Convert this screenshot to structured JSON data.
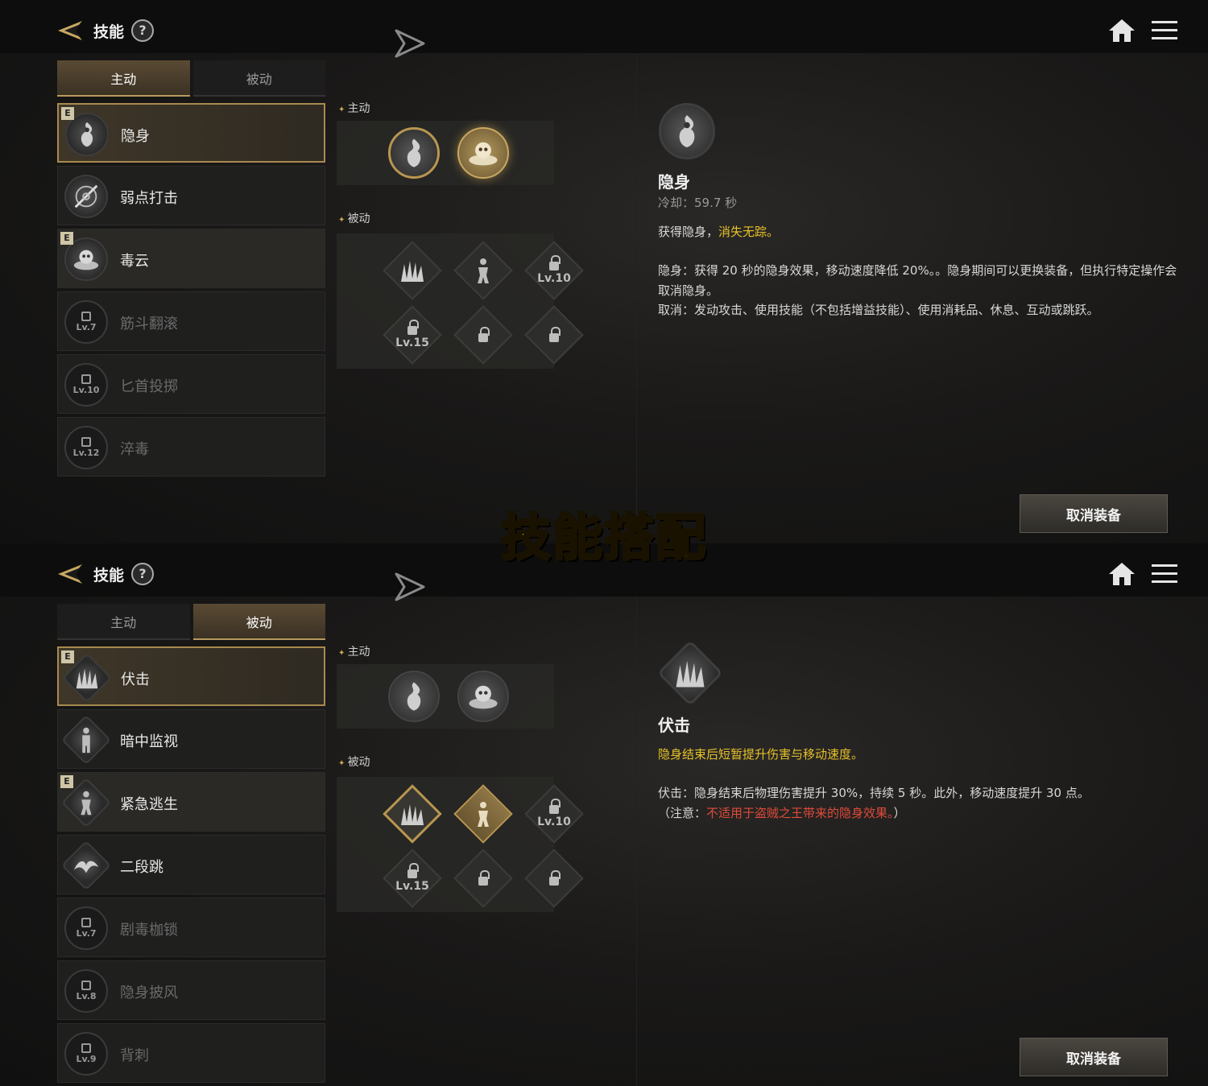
{
  "banner": "技能搭配",
  "panels": [
    {
      "header": {
        "title": "技能",
        "help": "?"
      },
      "tabs": [
        {
          "label": "主动",
          "active": true
        },
        {
          "label": "被动",
          "active": false
        }
      ],
      "skills": [
        {
          "name": "隐身",
          "equipped": true,
          "selected": true,
          "locked": false,
          "icon": "flame-figure-icon"
        },
        {
          "name": "弱点打击",
          "equipped": false,
          "selected": false,
          "locked": false,
          "icon": "target-slash-icon"
        },
        {
          "name": "毒云",
          "equipped": true,
          "selected": false,
          "locked": false,
          "icon": "skull-cloud-icon"
        },
        {
          "name": "筋斗翻滚",
          "locked": true,
          "lv": "Lv.7"
        },
        {
          "name": "匕首投掷",
          "locked": true,
          "lv": "Lv.10"
        },
        {
          "name": "淬毒",
          "locked": true,
          "lv": "Lv.12"
        }
      ],
      "active_section": {
        "label": "主动"
      },
      "passive_section": {
        "label": "被动",
        "locks": [
          "Lv.10",
          "Lv.15"
        ]
      },
      "detail": {
        "name": "隐身",
        "cooldown": "冷却：59.7 秒",
        "summary_plain": "获得隐身，",
        "summary_highlight": "消失无踪。",
        "desc1": "隐身：获得 20 秒的隐身效果，移动速度降低 20%。。隐身期间可以更换装备，但执行特定操作会取消隐身。",
        "desc2": "取消：发动攻击、使用技能（不包括增益技能）、使用消耗品、休息、互动或跳跃。"
      },
      "button": "取消装备"
    },
    {
      "header": {
        "title": "技能",
        "help": "?"
      },
      "tabs": [
        {
          "label": "主动",
          "active": false
        },
        {
          "label": "被动",
          "active": true
        }
      ],
      "skills": [
        {
          "name": "伏击",
          "equipped": true,
          "selected": true,
          "locked": false,
          "icon": "grass-icon"
        },
        {
          "name": "暗中监视",
          "equipped": false,
          "selected": false,
          "locked": false,
          "icon": "watcher-icon"
        },
        {
          "name": "紧急逃生",
          "equipped": true,
          "selected": false,
          "locked": false,
          "icon": "escape-icon"
        },
        {
          "name": "二段跳",
          "equipped": false,
          "selected": false,
          "locked": false,
          "icon": "bird-icon"
        },
        {
          "name": "剧毒枷锁",
          "locked": true,
          "lv": "Lv.7"
        },
        {
          "name": "隐身披风",
          "locked": true,
          "lv": "Lv.8"
        },
        {
          "name": "背刺",
          "locked": true,
          "lv": "Lv.9"
        }
      ],
      "active_section": {
        "label": "主动"
      },
      "passive_section": {
        "label": "被动",
        "locks": [
          "Lv.10",
          "Lv.15"
        ]
      },
      "detail": {
        "name": "伏击",
        "summary_highlight": "隐身结束后短暂提升伤害与移动速度。",
        "desc1": "伏击：隐身结束后物理伤害提升 30%，持续 5 秒。此外，移动速度提升 30 点。",
        "note_open": "（注意：",
        "note_red": "不适用于盗贼之王带来的隐身效果。",
        "note_close": "）"
      },
      "button": "取消装备"
    }
  ],
  "colors": {
    "gold": "#b99650",
    "highlight_yellow": "#e6c22a",
    "highlight_red": "#e04a3a",
    "banner": "#f8c42a"
  }
}
